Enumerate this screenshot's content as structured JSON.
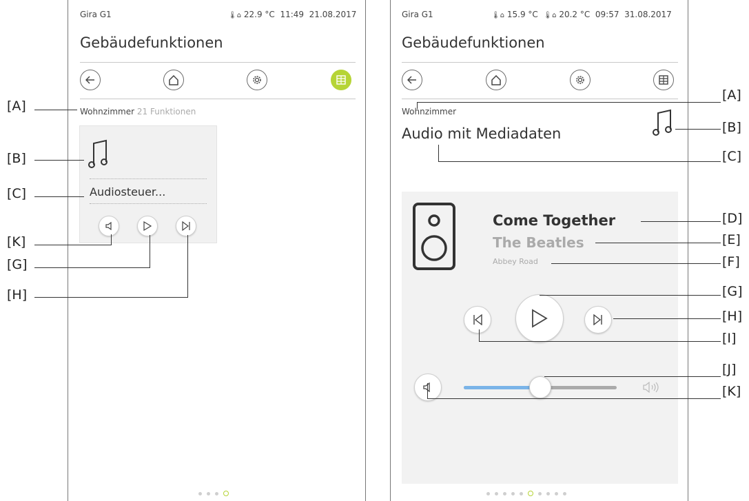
{
  "left_screen": {
    "status": {
      "device": "Gira G1",
      "temperature": "22.9 °C",
      "time": "11:49",
      "date": "21.08.2017"
    },
    "page_title": "Gebäudefunktionen",
    "nav": [
      "back",
      "home",
      "settings",
      "grid"
    ],
    "room": {
      "name": "Wohnzimmer",
      "count": "21",
      "functions": "Funktionen"
    },
    "tile": {
      "icon": "music-note-icon",
      "label": "Audiosteuer..."
    },
    "page_dots": {
      "total": 4,
      "active": 4
    }
  },
  "right_screen": {
    "status": {
      "device": "Gira G1",
      "temperature_outside": "15.9 °C",
      "temperature_inside": "20.2 °C",
      "time": "09:57",
      "date": "31.08.2017"
    },
    "page_title": "Gebäudefunktionen",
    "room": "Wohnzimmer",
    "function_title": "Audio mit Mediadaten",
    "media": {
      "title": "Come Together",
      "artist": "The Beatles",
      "album": "Abbey Road"
    },
    "volume_fraction": 0.5,
    "page_dots": {
      "total": 10,
      "active": 6
    }
  },
  "callouts": {
    "left": [
      "[A]",
      "[B]",
      "[C]",
      "[K]",
      "[G]",
      "[H]"
    ],
    "right": [
      "[A]",
      "[B]",
      "[C]",
      "[D]",
      "[E]",
      "[F]",
      "[G]",
      "[H]",
      "[I]",
      "[J]",
      "[K]"
    ]
  },
  "colors": {
    "accent": "#b6d436",
    "slider_fill": "#7ab4e8",
    "panel_bg": "#f2f2f2"
  }
}
